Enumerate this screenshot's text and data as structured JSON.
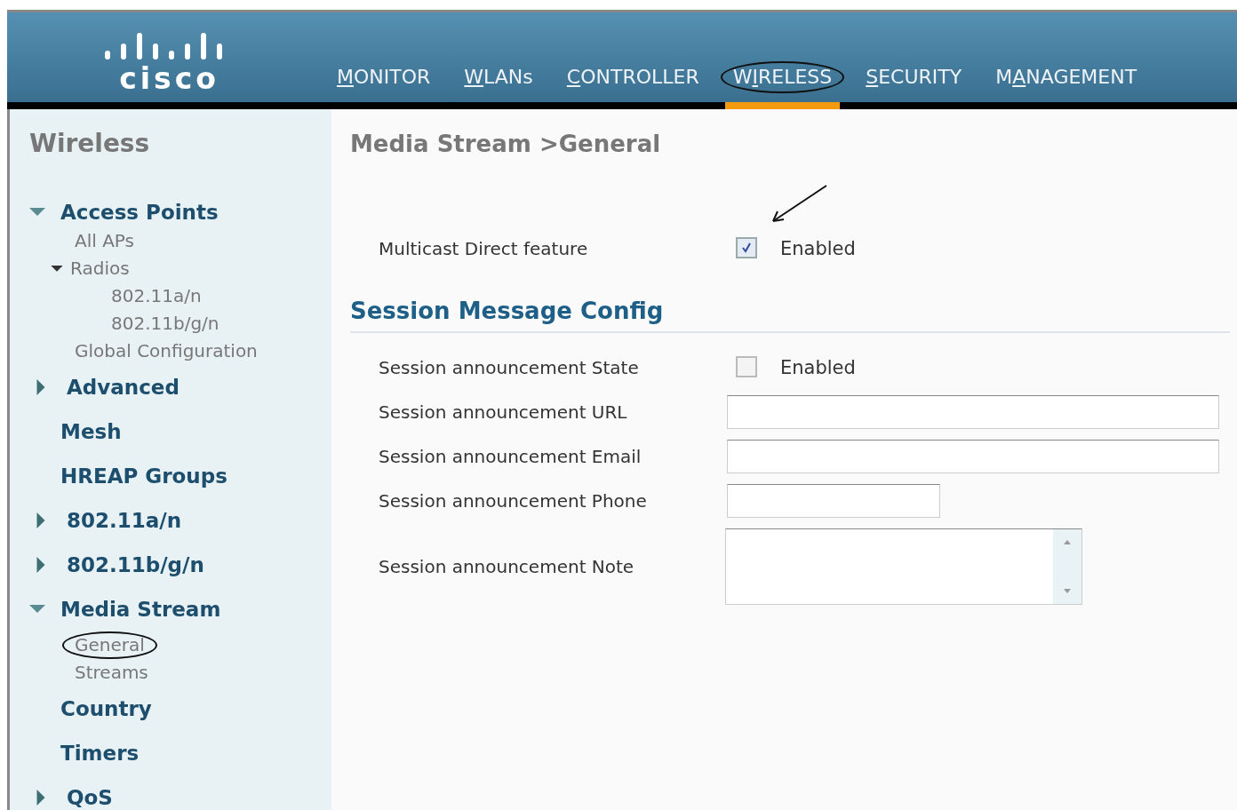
{
  "header": {
    "logo": "cisco",
    "nav": [
      {
        "key": "M",
        "after": "ONITOR",
        "selected": false
      },
      {
        "key": "W",
        "after": "LANs",
        "selected": false
      },
      {
        "key": "C",
        "after": "ONTROLLER",
        "selected": false
      },
      {
        "before": "W",
        "key": "I",
        "after": "RELESS",
        "selected": true
      },
      {
        "key": "S",
        "after": "ECURITY",
        "selected": false
      },
      {
        "before": "M",
        "key": "A",
        "after": "NAGEMENT",
        "selected": false
      }
    ]
  },
  "sidebar": {
    "title": "Wireless",
    "items": [
      {
        "label": "Access Points",
        "expanded": true,
        "selected": false,
        "children": [
          {
            "label": "All APs",
            "selected": false
          },
          {
            "label": "Radios",
            "expanded": true,
            "selected": false,
            "children": [
              {
                "label": "802.11a/n",
                "selected": false
              },
              {
                "label": "802.11b/g/n",
                "selected": false
              }
            ]
          },
          {
            "label": "Global Configuration",
            "selected": false
          }
        ]
      },
      {
        "label": "Advanced",
        "expanded": false,
        "selected": false
      },
      {
        "label": "Mesh",
        "selected": false
      },
      {
        "label": "HREAP Groups",
        "selected": false
      },
      {
        "label": "802.11a/n",
        "expanded": false,
        "selected": false
      },
      {
        "label": "802.11b/g/n",
        "expanded": false,
        "selected": false
      },
      {
        "label": "Media Stream",
        "expanded": true,
        "selected": false,
        "children": [
          {
            "label": "General",
            "selected": true
          },
          {
            "label": "Streams",
            "selected": false
          }
        ]
      },
      {
        "label": "Country",
        "selected": false
      },
      {
        "label": "Timers",
        "selected": false
      },
      {
        "label": "QoS",
        "expanded": false,
        "selected": false
      }
    ]
  },
  "page": {
    "title": "Media Stream >General",
    "top_rows": [
      {
        "label": "Multicast Direct feature",
        "kind": "checkbox",
        "checked": true,
        "option": "Enabled",
        "annotated": true
      }
    ],
    "section": "Session Message Config",
    "rows": [
      {
        "label": "Session announcement State",
        "kind": "checkbox",
        "checked": false,
        "option": "Enabled"
      },
      {
        "label": "Session announcement URL",
        "kind": "field"
      },
      {
        "label": "Session announcement Email",
        "kind": "field"
      },
      {
        "label": "Session announcement Phone",
        "kind": "shortfield"
      },
      {
        "label": "Session announcement Note",
        "kind": "textarea"
      }
    ]
  }
}
